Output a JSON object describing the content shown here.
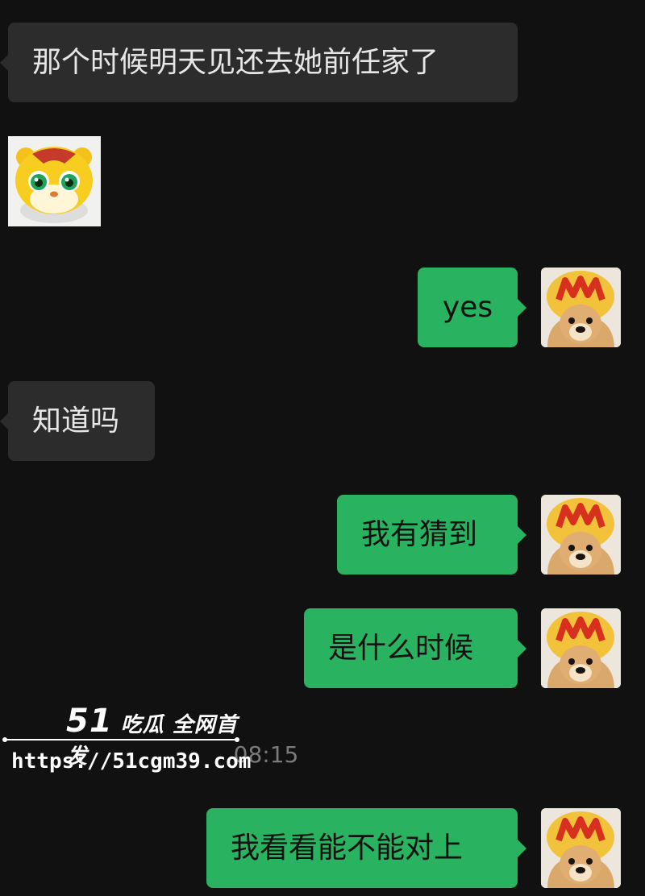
{
  "messages": [
    {
      "side": "in",
      "text": "那个时候明天见还去她前任家了"
    },
    {
      "side": "in",
      "type": "sticker",
      "sticker": "cartoon-tiger-sticker"
    },
    {
      "side": "out",
      "text": "yes"
    },
    {
      "side": "in",
      "text": "知道吗"
    },
    {
      "side": "out",
      "text": "我有猜到"
    },
    {
      "side": "out",
      "text": "是什么时候"
    },
    {
      "side": "out",
      "text": "我看看能不能对上"
    }
  ],
  "timestamp": "08:15",
  "watermark": {
    "brand_number": "51",
    "brand_text": "吃瓜 全网首发",
    "url": "https://51cgm39.com"
  },
  "self_avatar": "dog-mcdonalds-hat-avatar",
  "colors": {
    "background": "#111111",
    "incoming_bubble": "#2c2c2c",
    "outgoing_bubble": "#29b25f"
  }
}
